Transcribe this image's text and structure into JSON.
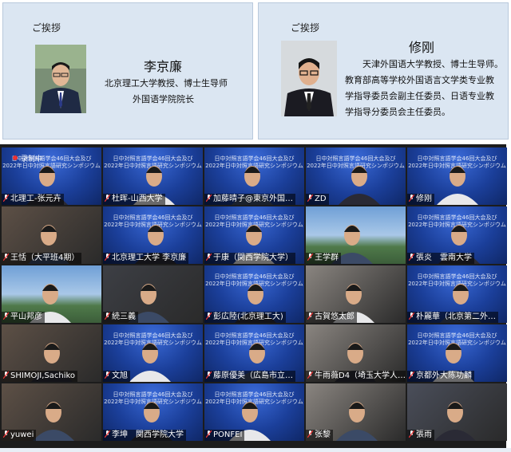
{
  "cards": [
    {
      "greeting": "ご挨拶",
      "name": "李京廉",
      "lines": [
        "北京理工大学教授、博士生导师",
        "外国语学院院长"
      ]
    },
    {
      "greeting": "ご挨拶",
      "name": "修刚",
      "lines": [
        "天津外国语大学教授、博士生导师。",
        "教育部高等学校外国语言文学类专业教",
        "学指导委员会副主任委员、日语专业教",
        "学指导分委员会主任委员。"
      ]
    }
  ],
  "meeting": {
    "recording_label": "录制中",
    "banner_line1": "日中対照言語学会46回大会及び",
    "banner_line2": "2022年日中対照言語研究シンポジウム",
    "participants": [
      "北理工-张元卉",
      "杜晖-山西大学",
      "加藤晴子@東京外国…",
      "ZD",
      "修刚",
      "王恬（大平班4期）",
      "北京理工大学 李京廉",
      "于康（関西学院大学）",
      "王学群",
      "張炎　雲南大学",
      "平山邦彦",
      "続三義",
      "彭広陸(北京理工大)",
      "古賀悠太郎",
      "朴麗華（北京第二外…",
      "SHIMOJI,Sachiko",
      "文旭",
      "藤原優美（広島市立…",
      "牛雨薇D4（埼玉大学人…",
      "京都外大陈功麟",
      "yuwei",
      "李坤　関西学院大学",
      "PONFEI",
      "张黎",
      "張雨"
    ]
  },
  "colors": {
    "card_bg": "#dbe6f2",
    "tile_blue": "#1b3f9a",
    "frame": "#1c1c1c"
  }
}
